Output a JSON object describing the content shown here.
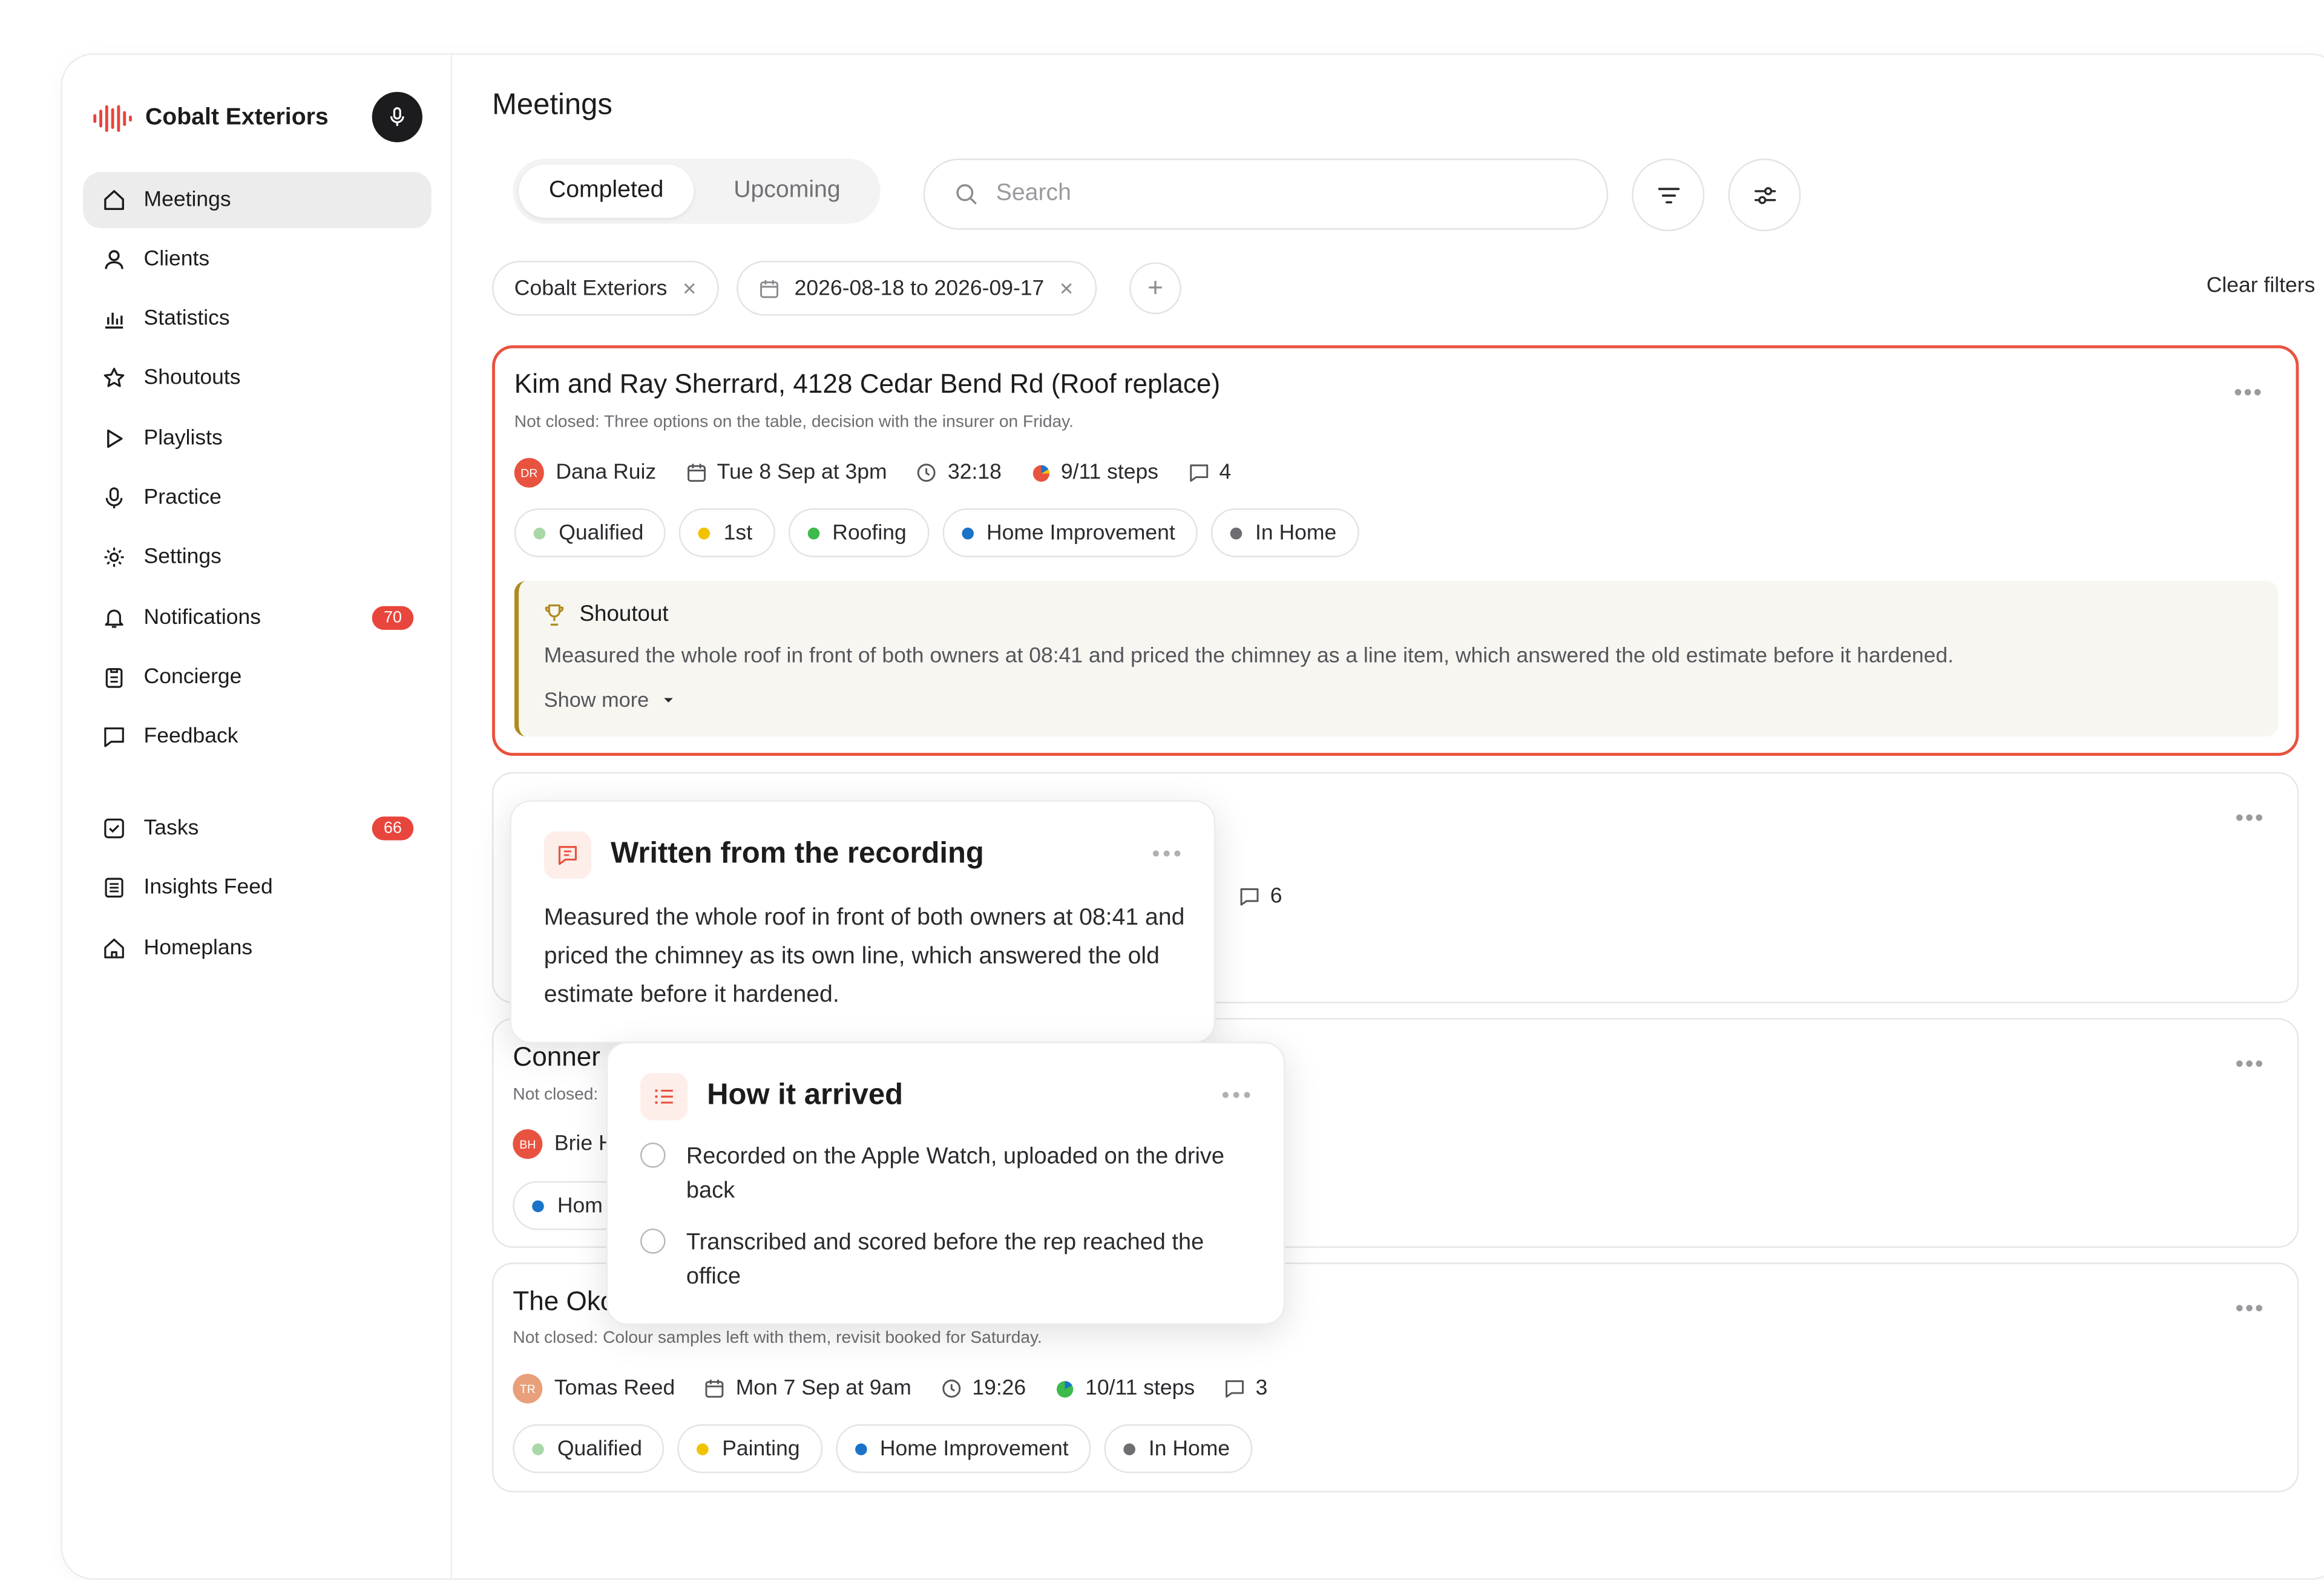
{
  "brand": {
    "name": "Cobalt Exteriors",
    "logo_icon": "sound-wave-logo",
    "accent": "#e8453c"
  },
  "nav": [
    {
      "label": "Meetings",
      "icon": "home-icon",
      "active": true
    },
    {
      "label": "Clients",
      "icon": "user-icon"
    },
    {
      "label": "Statistics",
      "icon": "bar-chart-icon"
    },
    {
      "label": "Shoutouts",
      "icon": "star-icon"
    },
    {
      "label": "Playlists",
      "icon": "play-icon"
    },
    {
      "label": "Practice",
      "icon": "mic-icon"
    },
    {
      "label": "Settings",
      "icon": "gear-icon"
    },
    {
      "label": "Notifications",
      "icon": "bell-icon",
      "badge": "70"
    },
    {
      "label": "Concierge",
      "icon": "clipboard-icon"
    },
    {
      "label": "Feedback",
      "icon": "chat-icon"
    },
    {
      "label": "Tasks",
      "icon": "checkbox-icon",
      "badge": "66"
    },
    {
      "label": "Insights Feed",
      "icon": "document-icon"
    },
    {
      "label": "Homeplans",
      "icon": "house-icon"
    }
  ],
  "header": {
    "title": "Meetings"
  },
  "tabs": {
    "completed": "Completed",
    "upcoming": "Upcoming",
    "active": "Completed"
  },
  "search": {
    "placeholder": "Search"
  },
  "filters": {
    "company": "Cobalt Exteriors",
    "date_range": "2026-08-18 to 2026-09-17",
    "clear": "Clear filters"
  },
  "meetings": [
    {
      "title": "Kim and Ray Sherrard, 4128 Cedar Bend Rd (Roof replace)",
      "subtitle": "Not closed: Three options on the table, decision with the insurer on Friday.",
      "rep_initials": "DR",
      "rep": "Dana Ruiz",
      "date": "Tue 8 Sep at 3pm",
      "duration": "32:18",
      "steps": "9/11 steps",
      "comments": "4",
      "tags": [
        {
          "label": "Qualified",
          "color": "#a8d8a8"
        },
        {
          "label": "1st",
          "color": "#f2c200"
        },
        {
          "label": "Roofing",
          "color": "#3cba4a"
        },
        {
          "label": "Home Improvement",
          "color": "#1a73c8"
        },
        {
          "label": "In Home",
          "color": "#6d6d72"
        }
      ],
      "shoutout": {
        "label": "Shoutout",
        "text": "Measured the whole roof in front of both owners at 08:41 and priced the chimney as a line item, which answered the old estimate before it hardened.",
        "show_more": "Show more"
      }
    },
    {
      "comments": "6"
    },
    {
      "title_visible": "Conner",
      "subtitle_visible": "Not closed:",
      "rep_initials": "BH",
      "rep_visible": "Brie H",
      "tag_visible": "Hom"
    },
    {
      "title_visible": "The Oko",
      "subtitle": "Not closed: Colour samples left with them, revisit booked for Saturday.",
      "rep_initials": "TR",
      "rep": "Tomas Reed",
      "date": "Mon 7 Sep at 9am",
      "duration": "19:26",
      "steps": "10/11 steps",
      "comments": "3",
      "tags": [
        {
          "label": "Qualified",
          "color": "#a8d8a8"
        },
        {
          "label": "Painting",
          "color": "#f2c200"
        },
        {
          "label": "Home Improvement",
          "color": "#1a73c8"
        },
        {
          "label": "In Home",
          "color": "#6d6d72"
        }
      ]
    }
  ],
  "popover_written": {
    "title": "Written from the recording",
    "body": "Measured the whole roof in front of both owners at 08:41 and priced the chimney as its own line, which answered the old estimate before it hardened."
  },
  "popover_arrived": {
    "title": "How it arrived",
    "items": [
      "Recorded on the Apple Watch, uploaded on the drive back",
      "Transcribed and scored before the rep reached the office"
    ]
  }
}
